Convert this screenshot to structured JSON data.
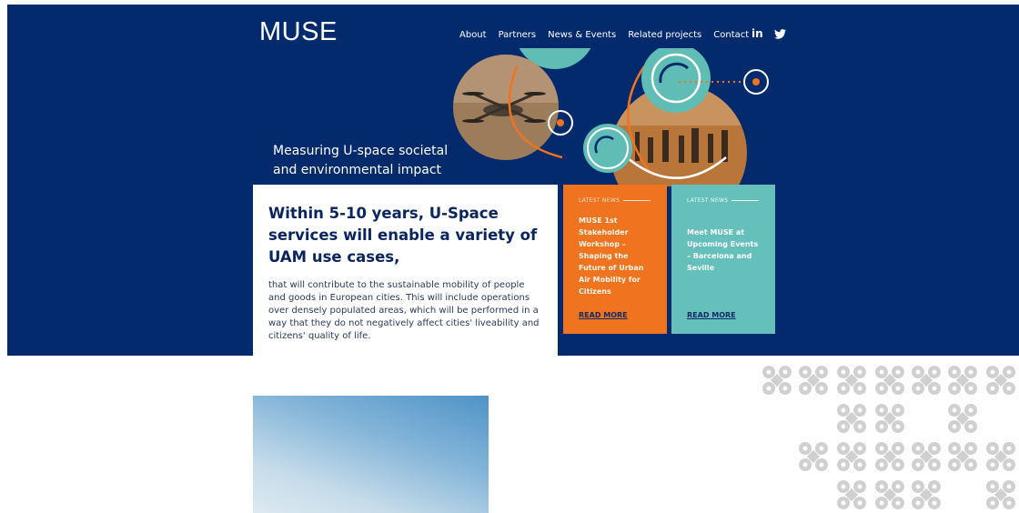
{
  "brand": {
    "logo": "MUSE"
  },
  "nav": {
    "items": [
      {
        "label": "About"
      },
      {
        "label": "Partners"
      },
      {
        "label": "News & Events"
      },
      {
        "label": "Related projects"
      },
      {
        "label": "Contact"
      }
    ],
    "social": {
      "linkedin": "in"
    }
  },
  "hero": {
    "tagline_line1": "Measuring U-space societal",
    "tagline_line2": "and environmental impact"
  },
  "intro": {
    "heading": "Within 5-10 years, U-Space services will enable a variety of UAM use cases,",
    "body": "that will contribute to the sustainable mobility of people and goods in European cities. This will include operations over densely populated areas, which will be performed in a way that they do not negatively affect cities' liveability and citizens' quality of life."
  },
  "news": [
    {
      "label": "LATEST NEWS",
      "title": "MUSE 1st Stakeholder Workshop – Shaping the Future of Urban Air Mobility for Citizens",
      "link": "READ MORE"
    },
    {
      "label": "LATEST NEWS",
      "title": "Meet MUSE at Upcoming Events – Barcelona and Seville",
      "link": "READ MORE"
    }
  ],
  "colors": {
    "navy": "#032a6c",
    "orange": "#f0731f",
    "teal": "#65c0bb",
    "pattern": "#d0d0d0"
  },
  "icons": [
    "linkedin-icon",
    "twitter-icon",
    "drone-photo",
    "crowd-photo",
    "target-circle-icon",
    "drone-pattern"
  ]
}
